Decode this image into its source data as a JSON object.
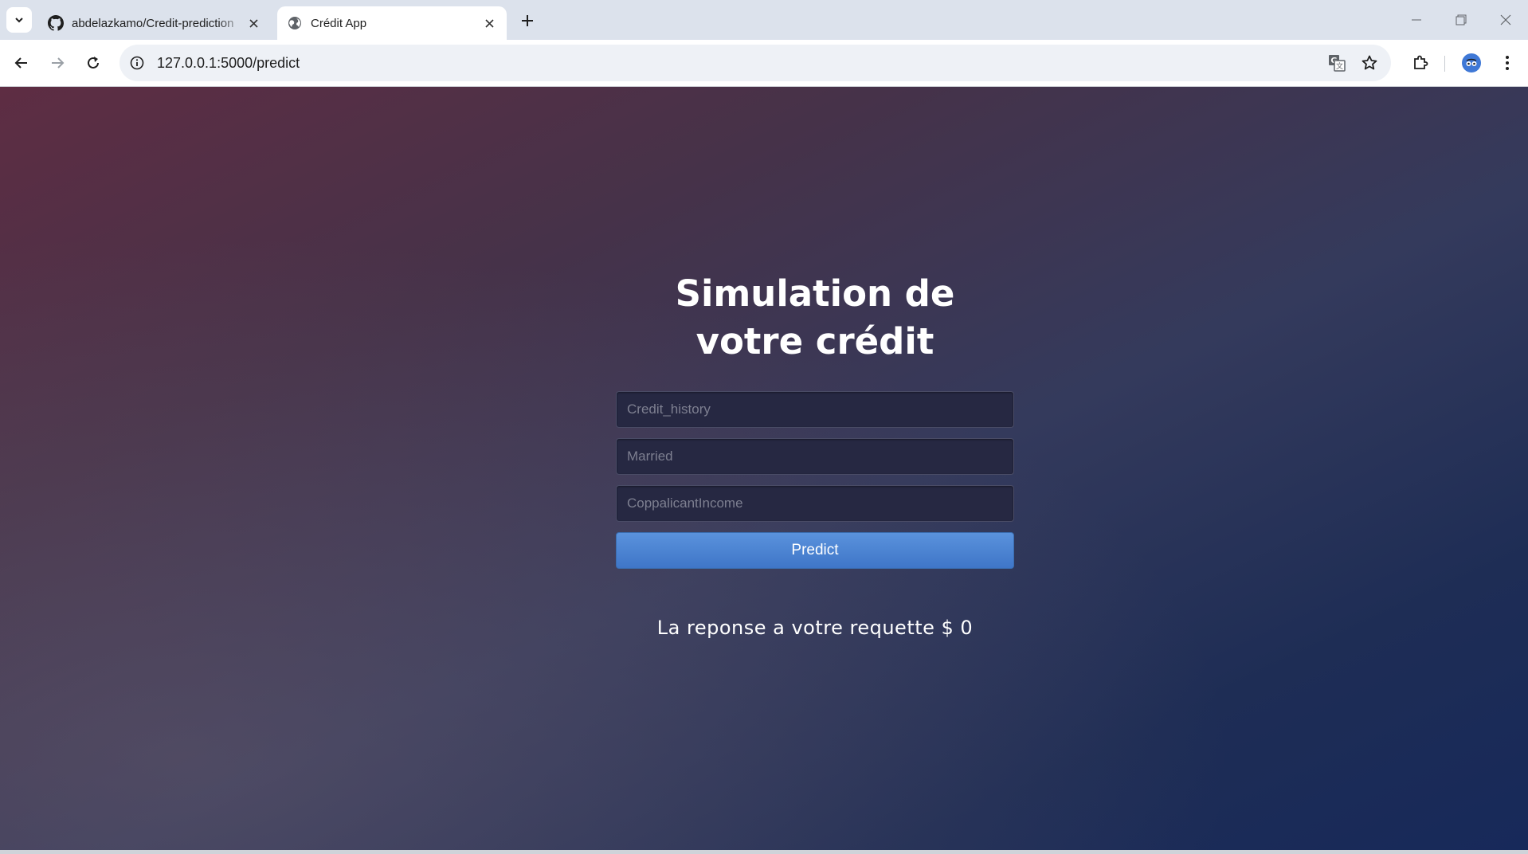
{
  "browser": {
    "tabs": [
      {
        "title": "abdelazkamo/Credit-prediction",
        "favicon": "github-icon",
        "active": false
      },
      {
        "title": "Crédit App",
        "favicon": "globe-icon",
        "active": true
      }
    ],
    "url": "127.0.0.1:5000/predict"
  },
  "page": {
    "heading": "Simulation de votre crédit",
    "fields": {
      "credit_history_placeholder": "Credit_history",
      "married_placeholder": "Married",
      "coapplicant_income_placeholder": "CoppalicantIncome"
    },
    "predict_label": "Predict",
    "result_text": "La reponse a votre requette $ 0"
  },
  "colors": {
    "button": "#4a84d4",
    "field_bg": "#262842",
    "gradient_start": "#5e2d43",
    "gradient_end": "#17295a"
  }
}
